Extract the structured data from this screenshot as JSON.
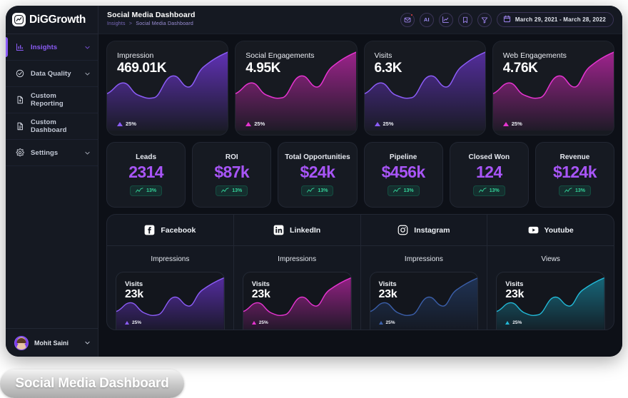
{
  "brand": {
    "name": "DiGGrowth",
    "logo_icon": "trend-line-logo-icon"
  },
  "sidebar": {
    "items": [
      {
        "label": "Insights",
        "icon": "bar-chart-icon",
        "chevron": true,
        "active": true
      },
      {
        "label": "Data Quality",
        "icon": "check-circle-icon",
        "chevron": true,
        "active": false
      },
      {
        "label": "Custom Reporting",
        "icon": "file-plus-icon",
        "chevron": false,
        "active": false
      },
      {
        "label": "Custom Dashboard",
        "icon": "file-lines-icon",
        "chevron": false,
        "active": false
      },
      {
        "label": "Settings",
        "icon": "gear-icon",
        "chevron": true,
        "active": false
      }
    ],
    "profile": {
      "name": "Mohit Saini",
      "avatar": "user-avatar",
      "chevron_icon": "chevron-down-icon"
    }
  },
  "header": {
    "title": "Social Media Dashboard",
    "breadcrumb": {
      "parent": "Insights",
      "separator": ">",
      "current": "Social Media Dashboard"
    },
    "icons": [
      {
        "name": "mail-icon",
        "glyph": "envelope",
        "badge": true
      },
      {
        "name": "ai-icon",
        "glyph": "AI",
        "badge": false
      },
      {
        "name": "trend-chart-icon",
        "glyph": "chart",
        "badge": false
      },
      {
        "name": "bookmark-icon",
        "glyph": "bookmark",
        "badge": false
      },
      {
        "name": "filter-icon",
        "glyph": "funnel",
        "badge": false
      }
    ],
    "date_range": {
      "label": "March 29, 2021 - March 28, 2022",
      "icon": "calendar-icon"
    }
  },
  "metrics": [
    {
      "label": "Impression",
      "value": "469.01K",
      "delta": "25%",
      "accent": "#8b5cf6"
    },
    {
      "label": "Social Engagements",
      "value": "4.95K",
      "delta": "25%",
      "accent": "#d926c9"
    },
    {
      "label": "Visits",
      "value": "6.3K",
      "delta": "25%",
      "accent": "#8b5cf6"
    },
    {
      "label": "Web Engagements",
      "value": "4.76K",
      "delta": "25%",
      "accent": "#d926c9"
    }
  ],
  "kpis": [
    {
      "label": "Leads",
      "value": "2314",
      "delta": "13%"
    },
    {
      "label": "ROI",
      "value": "$87k",
      "delta": "13%"
    },
    {
      "label": "Total Opportunities",
      "value": "$24k",
      "delta": "13%"
    },
    {
      "label": "Pipeline",
      "value": "$456k",
      "delta": "13%"
    },
    {
      "label": "Closed Won",
      "value": "124",
      "delta": "13%"
    },
    {
      "label": "Revenue",
      "value": "$124k",
      "delta": "13%"
    }
  ],
  "kpi_accent": "#a855f7",
  "kpi_badge_color": "#34d399",
  "social": [
    {
      "platform": "Facebook",
      "icon": "facebook-icon",
      "metric": "Impressions",
      "card": {
        "label": "Visits",
        "value": "23k",
        "delta": "25%"
      },
      "accent": "#8b5cf6"
    },
    {
      "platform": "LinkedIn",
      "icon": "linkedin-icon",
      "metric": "Impressions",
      "card": {
        "label": "Visits",
        "value": "23k",
        "delta": "25%"
      },
      "accent": "#d926c9"
    },
    {
      "platform": "Instagram",
      "icon": "instagram-icon",
      "metric": "Impressions",
      "card": {
        "label": "Visits",
        "value": "23k",
        "delta": "25%"
      },
      "accent": "#3b5faa"
    },
    {
      "platform": "Youtube",
      "icon": "youtube-icon",
      "metric": "Views",
      "card": {
        "label": "Visits",
        "value": "23k",
        "delta": "25%"
      },
      "accent": "#22b8d6"
    }
  ],
  "caption": {
    "text": "Social Media Dashboard"
  },
  "chart_data": [
    {
      "type": "area",
      "title": "Impression",
      "series": [
        {
          "name": "Impression",
          "values": [
            38,
            46,
            52,
            44,
            34,
            30,
            31,
            38,
            54,
            62,
            58,
            50,
            52,
            64,
            74,
            82,
            90
          ]
        }
      ],
      "x": [
        1,
        2,
        3,
        4,
        5,
        6,
        7,
        8,
        9,
        10,
        11,
        12,
        13,
        14,
        15,
        16,
        17
      ],
      "ylim": [
        0,
        100
      ],
      "grid": false,
      "legend": "none"
    },
    {
      "type": "area",
      "title": "Social Engagements",
      "series": [
        {
          "name": "Social Engagements",
          "values": [
            38,
            46,
            52,
            44,
            34,
            30,
            31,
            38,
            54,
            62,
            58,
            50,
            52,
            64,
            74,
            82,
            90
          ]
        }
      ],
      "x": [
        1,
        2,
        3,
        4,
        5,
        6,
        7,
        8,
        9,
        10,
        11,
        12,
        13,
        14,
        15,
        16,
        17
      ],
      "ylim": [
        0,
        100
      ],
      "grid": false,
      "legend": "none"
    },
    {
      "type": "area",
      "title": "Visits",
      "series": [
        {
          "name": "Visits",
          "values": [
            38,
            46,
            52,
            44,
            34,
            30,
            31,
            38,
            54,
            62,
            58,
            50,
            52,
            64,
            74,
            82,
            90
          ]
        }
      ],
      "x": [
        1,
        2,
        3,
        4,
        5,
        6,
        7,
        8,
        9,
        10,
        11,
        12,
        13,
        14,
        15,
        16,
        17
      ],
      "ylim": [
        0,
        100
      ],
      "grid": false,
      "legend": "none"
    },
    {
      "type": "area",
      "title": "Web Engagements",
      "series": [
        {
          "name": "Web Engagements",
          "values": [
            38,
            46,
            52,
            44,
            34,
            30,
            31,
            38,
            54,
            62,
            58,
            50,
            52,
            64,
            74,
            82,
            90
          ]
        }
      ],
      "x": [
        1,
        2,
        3,
        4,
        5,
        6,
        7,
        8,
        9,
        10,
        11,
        12,
        13,
        14,
        15,
        16,
        17
      ],
      "ylim": [
        0,
        100
      ],
      "grid": false,
      "legend": "none"
    }
  ]
}
